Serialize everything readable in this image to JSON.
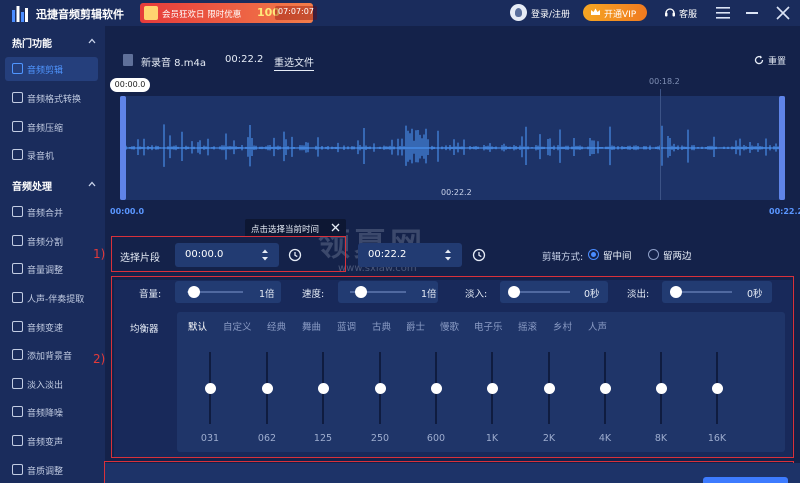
{
  "app": {
    "title": "迅捷音频剪辑软件",
    "promo_text": "会员狂欢日 限时优惠",
    "promo_number": "100",
    "promo_timer": "07:07:07",
    "login_label": "登录/注册",
    "vip_label": "开通VIP",
    "service_label": "客服"
  },
  "sidebar": {
    "section1": "热门功能",
    "section2": "音频处理",
    "items1": [
      {
        "label": "音频剪辑",
        "active": true
      },
      {
        "label": "音频格式转换"
      },
      {
        "label": "音频压缩"
      },
      {
        "label": "录音机"
      }
    ],
    "items2": [
      {
        "label": "音频合并"
      },
      {
        "label": "音频分割"
      },
      {
        "label": "音量调整"
      },
      {
        "label": "人声-伴奏提取"
      },
      {
        "label": "音频变速"
      },
      {
        "label": "添加背景音"
      },
      {
        "label": "淡入淡出"
      },
      {
        "label": "音频降噪"
      },
      {
        "label": "音频变声"
      },
      {
        "label": "音质调整"
      }
    ]
  },
  "file": {
    "name": "新录音 8.m4a",
    "duration": "00:22.2",
    "reselect": "重选文件",
    "reset": "重置"
  },
  "waveform": {
    "cursor_time": "00:00.0",
    "marker_time": "00:18.2",
    "center_time": "00:22.2",
    "start_time": "00:00.0",
    "end_time": "00:22.2"
  },
  "tooltip": {
    "text": "点击选择当前时间"
  },
  "segment": {
    "label": "选择片段",
    "start": "00:00.0",
    "end": "00:22.2",
    "mode_label": "剪辑方式:",
    "mode_keep_middle": "留中间",
    "mode_keep_edges": "留两边",
    "selected_mode": "留中间"
  },
  "controls": {
    "volume_label": "音量:",
    "volume_value": "1倍",
    "volume_level": 0.12,
    "speed_label": "速度:",
    "speed_value": "1倍",
    "speed_level": 0.2,
    "fadein_label": "淡入:",
    "fadein_value": "0秒",
    "fadein_level": 0,
    "fadeout_label": "淡出:",
    "fadeout_value": "0秒",
    "fadeout_level": 0
  },
  "equalizer": {
    "label": "均衡器",
    "presets": [
      "默认",
      "自定义",
      "经典",
      "舞曲",
      "蓝调",
      "古典",
      "爵士",
      "慢歌",
      "电子乐",
      "摇滚",
      "乡村",
      "人声"
    ],
    "active_preset": "默认",
    "bands": [
      "031",
      "062",
      "125",
      "250",
      "600",
      "1K",
      "2K",
      "4K",
      "8K",
      "16K"
    ],
    "band_levels": [
      0.5,
      0.5,
      0.5,
      0.5,
      0.5,
      0.5,
      0.5,
      0.5,
      0.5,
      0.5
    ]
  },
  "annotations": [
    "1)",
    "2)"
  ],
  "watermark": {
    "main": "领夏网",
    "sub": "www.sxiaw.com"
  },
  "colors": {
    "accent": "#4a8cff",
    "wave": "#4f9cff",
    "annotation": "#d8313b"
  }
}
